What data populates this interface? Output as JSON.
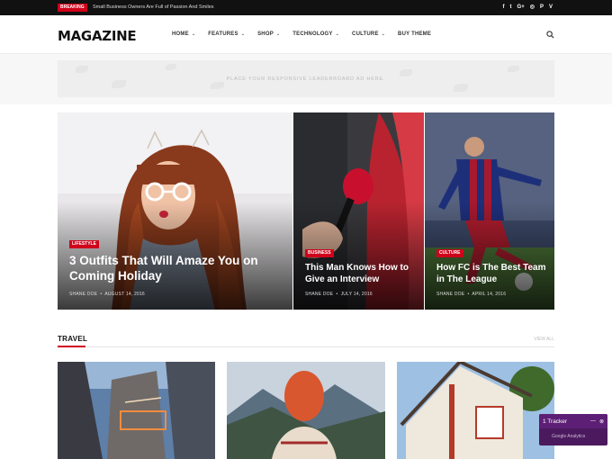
{
  "topbar": {
    "breaking_label": "Breaking",
    "ticker_text": "Small Business Owners Are Full of Passion And Smiles",
    "socials": [
      {
        "icon": "facebook-icon",
        "glyph": "f"
      },
      {
        "icon": "twitter-icon",
        "glyph": "t"
      },
      {
        "icon": "google-plus-icon",
        "glyph": "G+"
      },
      {
        "icon": "instagram-icon",
        "glyph": "◎"
      },
      {
        "icon": "pinterest-icon",
        "glyph": "P"
      },
      {
        "icon": "vimeo-icon",
        "glyph": "V"
      }
    ]
  },
  "header": {
    "logo": "MAGAZINE",
    "nav": [
      {
        "label": "HOME",
        "dropdown": true
      },
      {
        "label": "FEATURES",
        "dropdown": true
      },
      {
        "label": "SHOP",
        "dropdown": true
      },
      {
        "label": "TECHNOLOGY",
        "dropdown": true
      },
      {
        "label": "CULTURE",
        "dropdown": true
      },
      {
        "label": "BUY THEME",
        "dropdown": false
      }
    ],
    "search_icon": "search-icon"
  },
  "ad": {
    "text": "Place your responsive leaderboard ad here."
  },
  "featured": [
    {
      "category": "Lifestyle",
      "title": "3 Outfits That Will Amaze You on Coming Holiday",
      "author": "Shane Doe",
      "date": "August 14, 2016"
    },
    {
      "category": "Business",
      "title": "This Man Knows How to Give an Interview",
      "author": "Shane Doe",
      "date": "July 14, 2016"
    },
    {
      "category": "Culture",
      "title": "How FC is The Best Team in The League",
      "author": "Shane Doe",
      "date": "April 14, 2016"
    }
  ],
  "travel": {
    "title": "TRAVEL",
    "view_all": "View All"
  },
  "tracker": {
    "label": "1 Tracker",
    "sub": "Google Analytics"
  },
  "colors": {
    "accent": "#d0021b",
    "topbar": "#111111",
    "tracker": "#4b1a5e"
  }
}
